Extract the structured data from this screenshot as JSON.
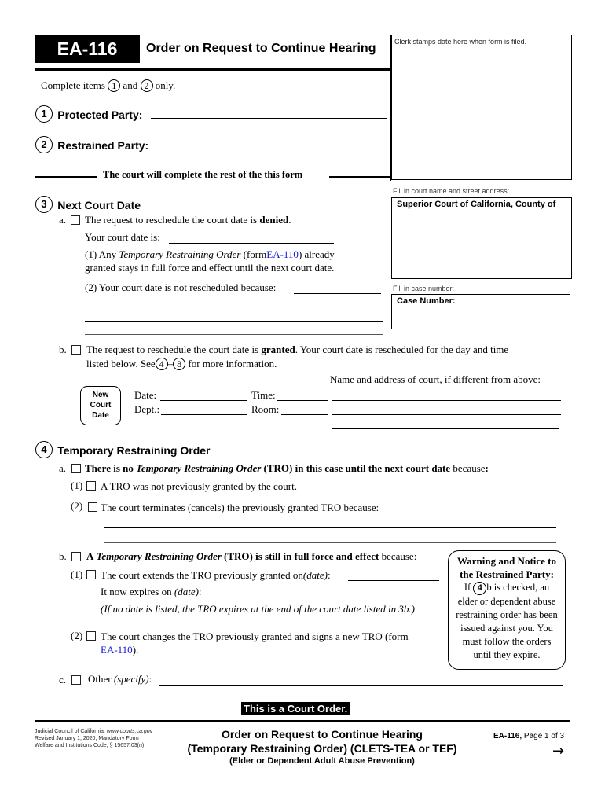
{
  "header": {
    "form_id": "EA-116",
    "form_title": "Order on Request to Continue Hearing",
    "clerk_stamp_label": "Clerk stamps date here when form is filed."
  },
  "intro": {
    "prefix": "Complete items",
    "item1": "1",
    "and": "and",
    "item2": "2",
    "suffix": "only."
  },
  "item1": {
    "number": "1",
    "label": "Protected Party:",
    "value": ""
  },
  "item2": {
    "number": "2",
    "label": "Restrained Party:",
    "value": ""
  },
  "court_divider": "The court will complete the rest of the this form",
  "court_box": {
    "label": "Fill in court name and street address:",
    "text": "Superior Court of California, County of",
    "value": ""
  },
  "case_box": {
    "label": "Fill in case number:",
    "text": "Case Number:",
    "value": ""
  },
  "item3": {
    "number": "3",
    "heading": "Next Court Date",
    "a": {
      "letter": "a.",
      "checked": false,
      "text_before": "The request to reschedule the court date is",
      "text_bold": "denied",
      "text_after": ".",
      "court_date_label": "Your court date is:",
      "court_date_value": "",
      "p1_prefix": "(1) Any",
      "p1_italic": "Temporary Restraining Order",
      "p1_form_open": "(form",
      "p1_link": "EA-110",
      "p1_suffix": ") already",
      "p1_line2": "granted stays in full force and effect until the next court date.",
      "p2_label": "(2) Your court date is not rescheduled because:",
      "p2_value": ""
    },
    "b": {
      "letter": "b.",
      "checked": false,
      "text_before": "The request to reschedule the court date is",
      "text_bold": "granted",
      "text_after": ". Your court date is rescheduled for the day and time",
      "line2_prefix": "listed below. See",
      "see_from": "4",
      "see_dash": "–",
      "see_to": "8",
      "line2_suffix": "for more information.",
      "badge": [
        "New",
        "Court",
        "Date"
      ],
      "date_label": "Date:",
      "time_label": "Time:",
      "dept_label": "Dept.:",
      "room_label": "Room:",
      "address_label": "Name and address of court, if different from above:",
      "date_value": "",
      "time_value": "",
      "dept_value": "",
      "room_value": ""
    }
  },
  "item4": {
    "number": "4",
    "heading": "Temporary Restraining Order",
    "a": {
      "letter": "a.",
      "checked": false,
      "bold1": "There is no",
      "italic": "Temporary Restraining Order",
      "bold2": "(TRO) in this case until the next court date",
      "normal": "because",
      "colon": ":",
      "opt1_num": "(1)",
      "opt1_text": "A TRO was not previously granted by the court.",
      "opt1_checked": false,
      "opt2_num": "(2)",
      "opt2_text": "The court terminates (cancels) the previously granted TRO because:",
      "opt2_checked": false
    },
    "b": {
      "letter": "b.",
      "checked": false,
      "bold1": "A",
      "italic": "Temporary Restraining Order",
      "bold2": "(TRO) is still in full force and effect",
      "normal": "because:",
      "opt1_num": "(1)",
      "opt1_text": "The court extends the TRO previously granted on",
      "opt1_date": "(date)",
      "opt1_colon": ":",
      "opt1_checked": false,
      "expires_text": "It now expires on",
      "expires_date": "(date)",
      "expires_colon": ":",
      "note": "(If no date is listed, the TRO expires at the end of the court date listed in 3b.)",
      "opt2_num": "(2)",
      "opt2_text": "The court changes the TRO previously granted and signs a new TRO (form",
      "opt2_link": "EA-110",
      "opt2_suffix": ").",
      "opt2_checked": false
    },
    "c": {
      "letter": "c.",
      "checked": false,
      "label": "Other",
      "italic": "(specify)",
      "colon": ":",
      "value": ""
    }
  },
  "warning": {
    "title_line1": "Warning and Notice to",
    "title_line2": "the Restrained Party:",
    "if": "If",
    "item": "4",
    "line1_rest": "b is checked, an",
    "line2": "elder or dependent abuse",
    "line3": "restraining order has been",
    "line4": "issued against you. You",
    "line5": "must follow the orders",
    "line6": "until they expire."
  },
  "footer": {
    "court_order": "This is a Court Order.",
    "council_prefix": "Judicial Council of California,",
    "council_url": "www.courts.ca.gov",
    "revised": "Revised January 1, 2020, Mandatory Form",
    "code": "Welfare and Institutions Code, § 15657.03(n)",
    "title1": "Order on Request to Continue Hearing",
    "title2": "(Temporary Restraining Order) (CLETS-TEA or TEF)",
    "title3": "(Elder or Dependent Adult Abuse Prevention)",
    "page_form": "EA-116,",
    "page_text": "Page 1 of 3",
    "next_icon": "→"
  }
}
